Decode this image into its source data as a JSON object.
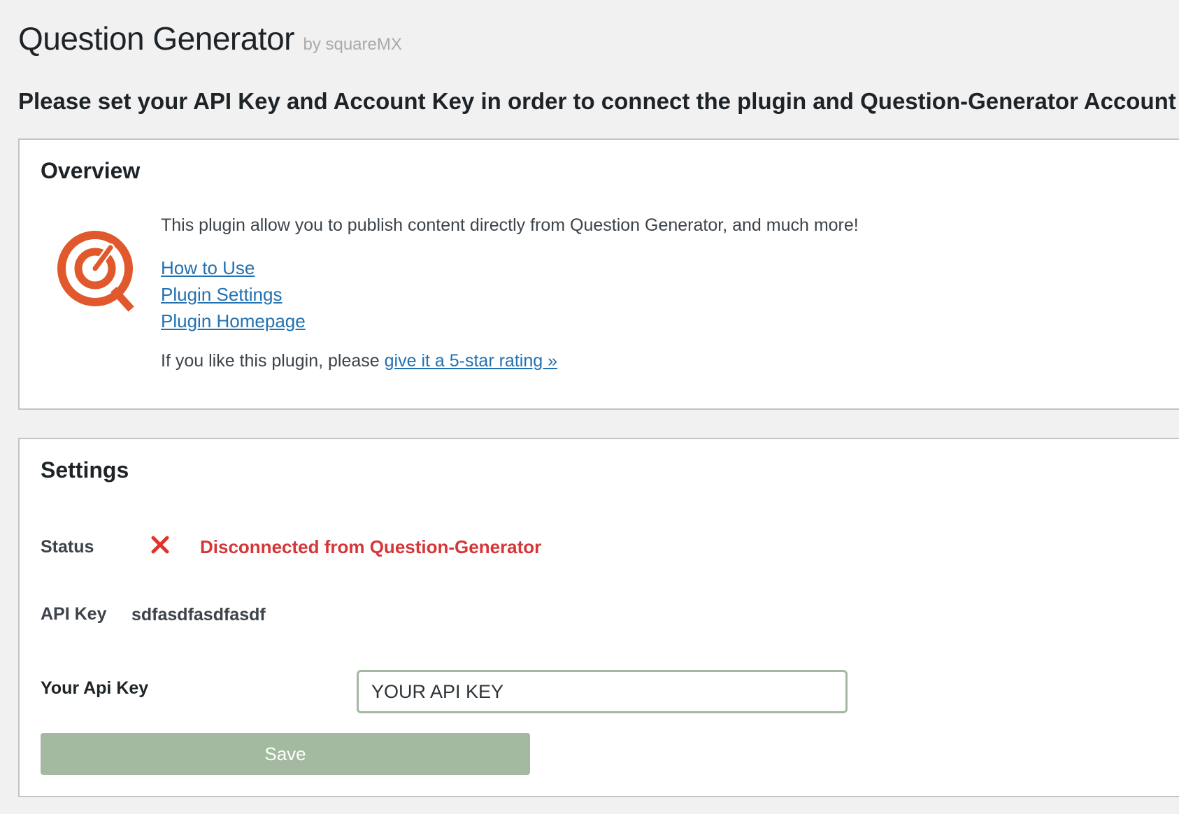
{
  "header": {
    "title": "Question Generator",
    "byline": "by squareMX"
  },
  "notice": "Please set your API Key and Account Key in order to connect the plugin and Question-Generator Account :",
  "overview": {
    "title": "Overview",
    "logo_icon": "question-generator-logo-icon",
    "logo_color": "#e0582b",
    "description": "This plugin allow you to publish content directly from Question Generator, and much more!",
    "links": [
      {
        "label": "How to Use"
      },
      {
        "label": "Plugin Settings"
      },
      {
        "label": "Plugin Homepage"
      }
    ],
    "rating_prefix": "If you like this plugin, please ",
    "rating_link": "give it a 5-star rating »"
  },
  "settings": {
    "title": "Settings",
    "status_label": "Status",
    "status_icon": "close-icon",
    "status_color": "#d63638",
    "status_text": "Disconnected from Question-Generator",
    "api_key_label": "API Key",
    "api_key_value": "sdfasdfasdfasdf",
    "your_api_key_label": "Your Api Key",
    "your_api_key_placeholder": "YOUR API KEY",
    "save_label": "Save",
    "accent_color": "#a3b9a0"
  }
}
